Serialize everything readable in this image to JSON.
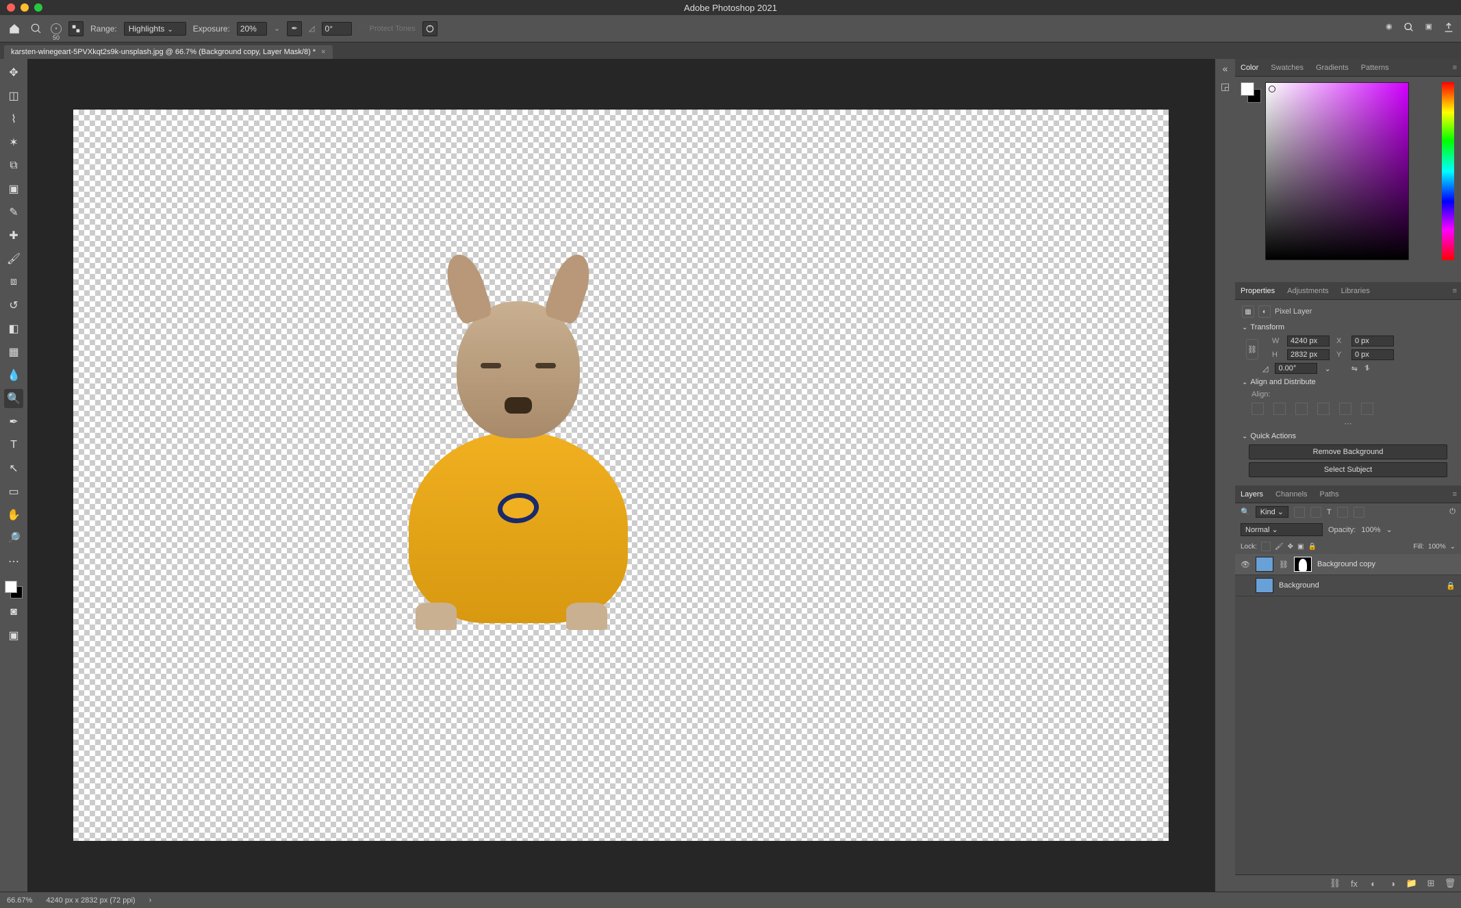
{
  "app_title": "Adobe Photoshop 2021",
  "options": {
    "range_label": "Range:",
    "range_value": "Highlights",
    "exposure_label": "Exposure:",
    "exposure_value": "20%",
    "angle_value": "0°",
    "protect_tones": "Protect Tones",
    "brush_size": "50"
  },
  "document_tab": "karsten-winegeart-5PVXkqt2s9k-unsplash.jpg @ 66.7% (Background copy, Layer Mask/8) *",
  "statusbar": {
    "zoom": "66.67%",
    "doc_info": "4240 px x 2832 px (72 ppi)"
  },
  "panel_group1": {
    "tabs": [
      "Color",
      "Swatches",
      "Gradients",
      "Patterns"
    ]
  },
  "panel_group2": {
    "tabs": [
      "Properties",
      "Adjustments",
      "Libraries"
    ]
  },
  "panel_group3": {
    "tabs": [
      "Layers",
      "Channels",
      "Paths"
    ]
  },
  "properties": {
    "type": "Pixel Layer",
    "sections": {
      "transform": "Transform",
      "align": "Align and Distribute",
      "align_label": "Align:",
      "quick": "Quick Actions"
    },
    "W": "4240 px",
    "H": "2832 px",
    "X": "0 px",
    "Y": "0 px",
    "angle": "0.00°",
    "qa": {
      "remove_bg": "Remove Background",
      "select_subject": "Select Subject"
    }
  },
  "layers": {
    "filter_kind": "Kind",
    "blend_mode": "Normal",
    "opacity_label": "Opacity:",
    "opacity": "100%",
    "lock_label": "Lock:",
    "fill_label": "Fill:",
    "fill": "100%",
    "items": [
      {
        "name": "Background copy",
        "visible": true,
        "has_mask": true,
        "locked": false
      },
      {
        "name": "Background",
        "visible": false,
        "has_mask": false,
        "locked": true
      }
    ]
  }
}
